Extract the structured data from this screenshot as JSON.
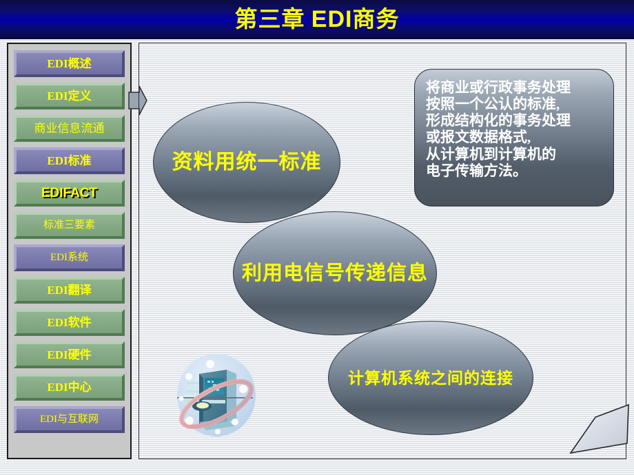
{
  "slide": {
    "title_prefix": "第三章 ",
    "title_latin": "EDI",
    "title_suffix": "商务",
    "title_full": "第三章 EDI商务",
    "accent_yellow": "#ffff00",
    "banner_color": "#0000a8",
    "sidebar_bg": "#c8c8c8",
    "purple_button": "#7b7bad",
    "green_button": "#85aa85",
    "ellipse_fill": "#707d8c"
  },
  "sidebar": {
    "items": [
      {
        "label": "EDI概述",
        "style": "purple"
      },
      {
        "label": "EDI定义",
        "style": "green"
      },
      {
        "label": "商业信息流通",
        "style": "green"
      },
      {
        "label": "EDI标准",
        "style": "purple"
      },
      {
        "label": "EDIFACT",
        "style": "green"
      },
      {
        "label": "标准三要素",
        "style": "green"
      },
      {
        "label": "EDI系统",
        "style": "purple"
      },
      {
        "label": "EDI翻译",
        "style": "green"
      },
      {
        "label": "EDI软件",
        "style": "green"
      },
      {
        "label": "EDI硬件",
        "style": "green"
      },
      {
        "label": "EDI中心",
        "style": "green"
      },
      {
        "label": "EDI与互联网",
        "style": "purple"
      }
    ]
  },
  "arrow": {
    "name": "right-pointing arrow"
  },
  "content": {
    "ellipses": [
      {
        "text": "资料用统一标准"
      },
      {
        "text": "利用电信号传递信息"
      },
      {
        "text": "计算机系统之间的连接"
      }
    ],
    "definition": {
      "lines": [
        "将商业或行政事务处理",
        "按照一个公认的标准,",
        "形成结构化的事务处理",
        "或报文数据格式,",
        "从计算机到计算机的",
        "电子传输方法。"
      ]
    },
    "clipart": {
      "name": "computer-network-globe-clipart"
    },
    "page_curl": {
      "name": "folded-page-corner"
    }
  }
}
